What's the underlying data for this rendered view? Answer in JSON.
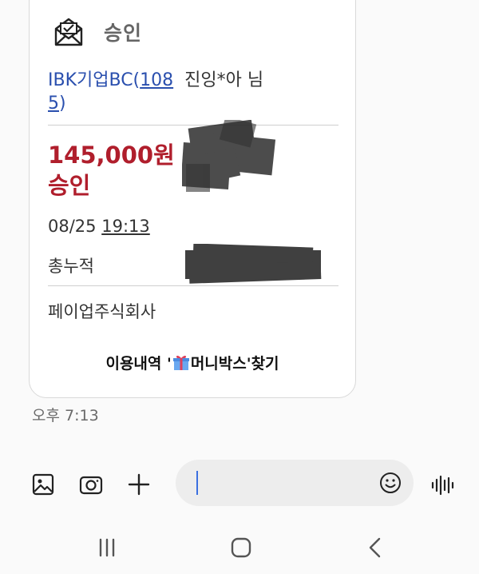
{
  "message": {
    "header_title": "승인",
    "sender": {
      "bank": "IBK기업BC(",
      "card_digits_1": "108",
      "card_digits_2": "5",
      "close_paren": ")",
      "name": "진잉*아 님"
    },
    "amount": "145,000원",
    "status": "승인",
    "date": "08/25",
    "time": "19:13",
    "total_label": "총누적",
    "merchant": "페이업주식회사",
    "promo_prefix": "이용내역 '",
    "promo_suffix": "머니박스'찾기"
  },
  "timestamp": "오후 7:13",
  "input": {
    "value": ""
  },
  "icons": {
    "header": "envelope-check-icon",
    "gallery": "image-icon",
    "camera": "camera-icon",
    "add": "plus-icon",
    "emoji": "smiley-icon",
    "voice": "voice-wave-icon",
    "promo": "gift-icon",
    "nav_recent": "recent-apps-icon",
    "nav_home": "home-icon",
    "nav_back": "back-icon"
  },
  "colors": {
    "amount": "#b01e2c",
    "sender": "#2a4fae",
    "cursor": "#3a6fe0"
  }
}
